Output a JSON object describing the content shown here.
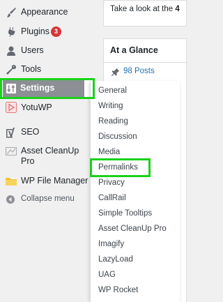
{
  "sidebar": {
    "items": [
      {
        "label": "Appearance",
        "icon": "paintbrush-icon"
      },
      {
        "label": "Plugins",
        "icon": "plugin-icon",
        "badge": "3"
      },
      {
        "label": "Users",
        "icon": "user-icon"
      },
      {
        "label": "Tools",
        "icon": "wrench-icon"
      },
      {
        "label": "Settings",
        "icon": "settings-sliders-icon"
      },
      {
        "label": "YotuWP",
        "icon": "play-icon"
      },
      {
        "label": "SEO",
        "icon": "yoast-seo-icon"
      },
      {
        "label": "Asset CleanUp Pro",
        "icon": "asset-cleanup-icon"
      },
      {
        "label": "WP File Manager",
        "icon": "folder-icon"
      },
      {
        "label": "Collapse menu",
        "icon": "collapse-icon"
      }
    ]
  },
  "submenu": {
    "items": [
      "General",
      "Writing",
      "Reading",
      "Discussion",
      "Media",
      "Permalinks",
      "Privacy",
      "CallRail",
      "Simple Tooltips",
      "Asset CleanUp Pro",
      "Imagify",
      "LazyLoad",
      "UAG",
      "WP Rocket"
    ]
  },
  "main": {
    "top_panel_text": "Take a look at the ",
    "top_panel_bold": "4",
    "glance_title": "At a Glance",
    "posts_link": "98 Posts"
  },
  "colors": {
    "highlight": "#1ad21a",
    "active_menu_bg": "#8c8f94",
    "badge": "#d63638",
    "link": "#2271b1"
  }
}
